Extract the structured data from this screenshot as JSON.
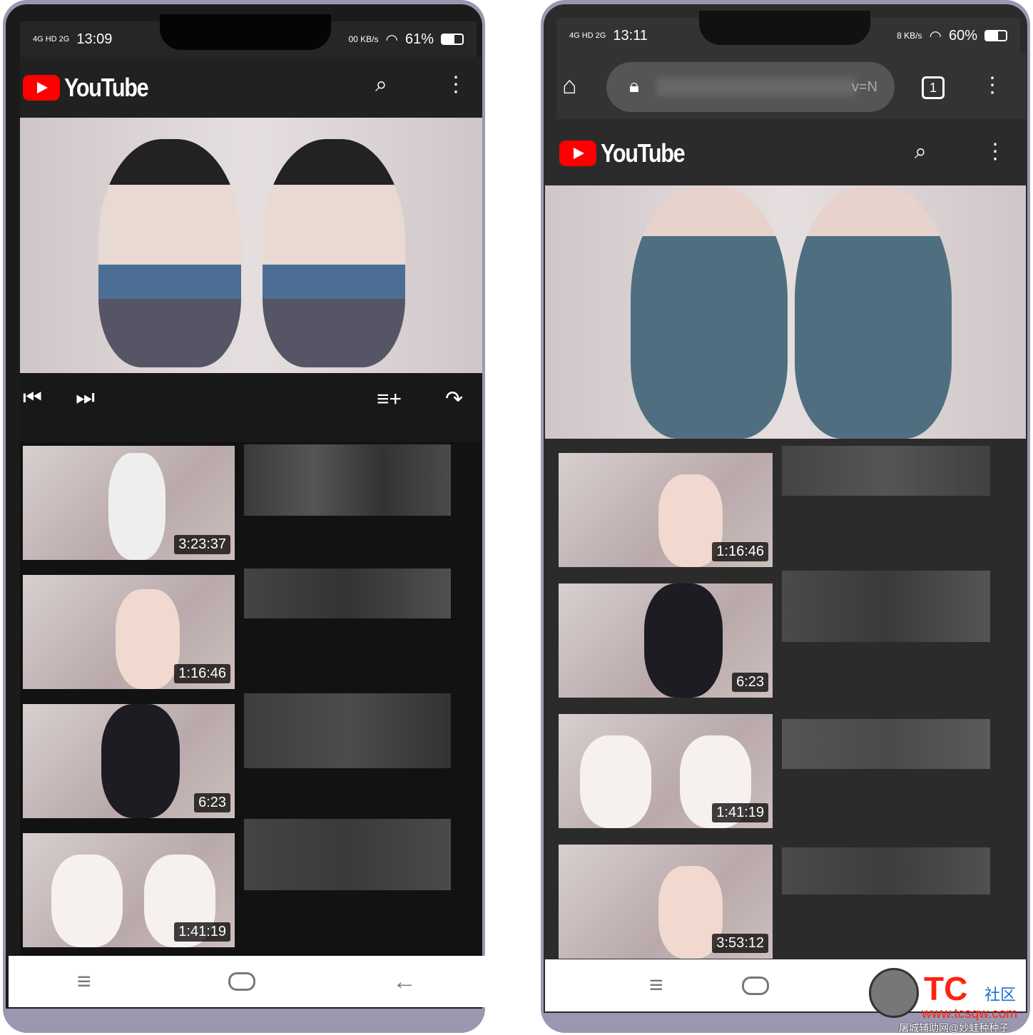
{
  "left": {
    "status": {
      "time": "13:09",
      "network": "4G HD 2G",
      "speed": "00 KB/s",
      "battery": "61%"
    },
    "app": {
      "logo": "YouTube",
      "search_icon": "search-icon",
      "menu_icon": "more-vert-icon"
    },
    "controls": {
      "prev": "skip-previous-icon",
      "next": "skip-next-icon",
      "add_queue": "playlist-add-icon",
      "share": "share-icon"
    },
    "videos": [
      {
        "duration": "3:23:37"
      },
      {
        "duration": "1:16:46"
      },
      {
        "duration": "6:23"
      },
      {
        "duration": "1:41:19"
      }
    ]
  },
  "right": {
    "status": {
      "time": "13:11",
      "network": "4G HD 2G",
      "speed": "8 KB/s",
      "battery": "60%"
    },
    "browser": {
      "url_suffix": "v=N",
      "tab_count": "1"
    },
    "app": {
      "logo": "YouTube"
    },
    "videos": [
      {
        "duration": "1:16:46"
      },
      {
        "duration": "6:23"
      },
      {
        "duration": "1:41:19"
      },
      {
        "duration": "3:53:12"
      }
    ]
  },
  "watermark": {
    "brand": "TC",
    "community": "社区",
    "url": "www.tcsqw.com",
    "caption": "屠城辅助网@妙蛙种种子"
  },
  "colors": {
    "youtube_red": "#ff0000",
    "dark_bg": "#212121"
  }
}
